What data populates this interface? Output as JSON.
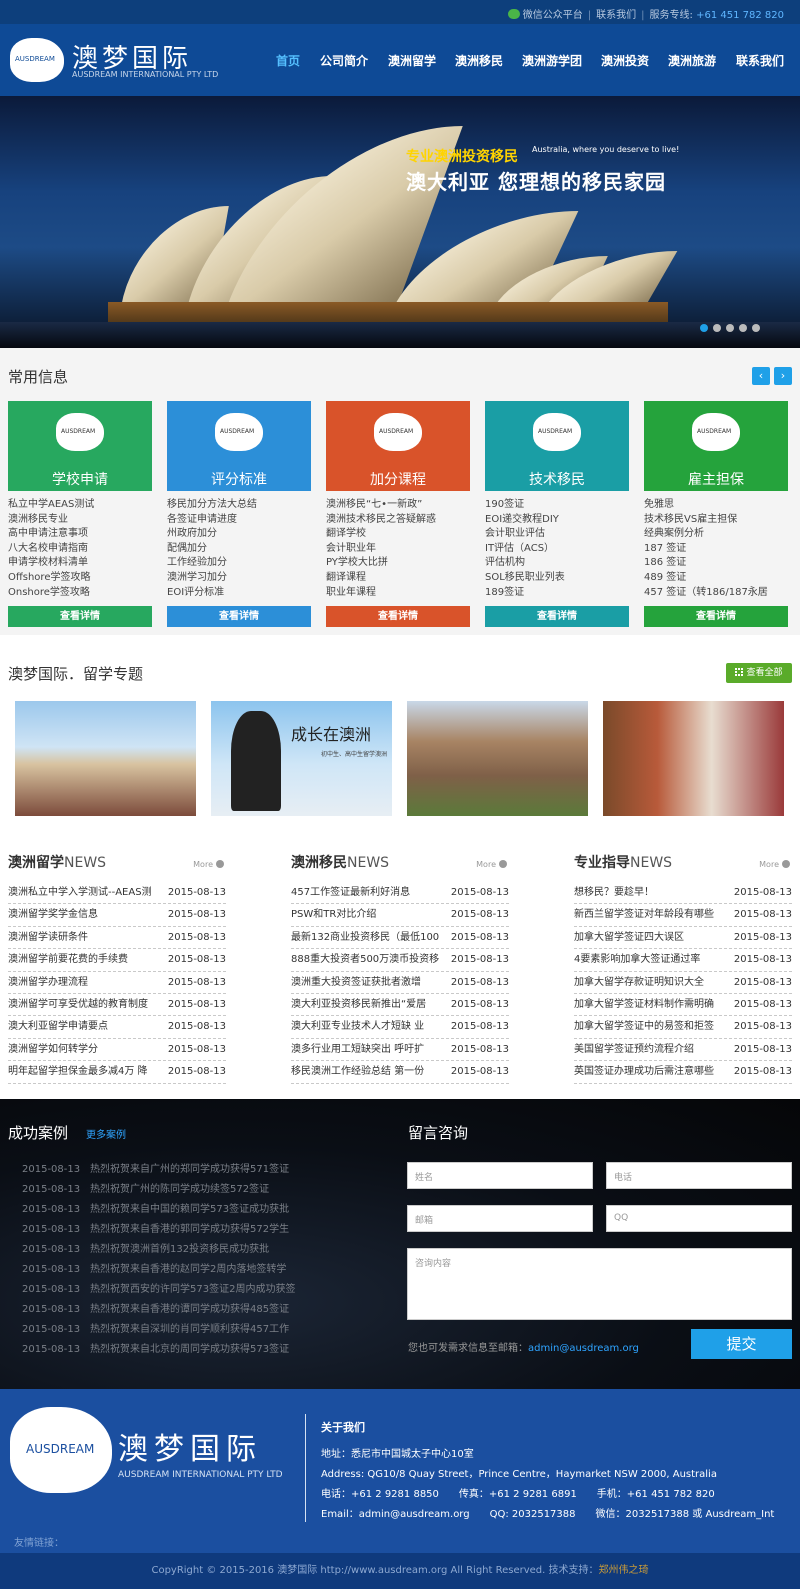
{
  "topbar": {
    "wechat": "微信公众平台",
    "contact": "联系我们",
    "hotline_label": "服务专线:",
    "hotline": "+61 451 782 820"
  },
  "logo": {
    "map_text": "AUSDREAM",
    "name_cn": "澳梦国际",
    "name_en": "AUSDREAM INTERNATIONAL PTY LTD"
  },
  "nav": {
    "items": [
      "首页",
      "公司简介",
      "澳洲留学",
      "澳洲移民",
      "澳洲游学团",
      "澳洲投资",
      "澳洲旅游",
      "联系我们"
    ],
    "active_index": 0
  },
  "banner": {
    "tagline_small": "专业澳洲投资移民",
    "tagline_en": "Australia, where you deserve to live!",
    "tagline_main": "澳大利亚  您理想的移民家园",
    "slide_count": 5,
    "active_slide": 0
  },
  "info": {
    "title": "常用信息",
    "prev": "‹",
    "next": "›",
    "cards": [
      {
        "title": "学校申请",
        "color": "#27a85f",
        "more": "查看详情",
        "items": [
          "私立中学AEAS测试",
          "澳洲移民专业",
          "高中申请注意事项",
          "八大名校申请指南",
          "申请学校材料清单",
          "Offshore学签攻略",
          "Onshore学签攻略"
        ]
      },
      {
        "title": "评分标准",
        "color": "#2c8fd8",
        "more": "查看详情",
        "items": [
          "移民加分方法大总结",
          "各签证申请进度",
          "州政府加分",
          "配偶加分",
          "工作经验加分",
          "澳洲学习加分",
          "EOI评分标准"
        ]
      },
      {
        "title": "加分课程",
        "color": "#d9532a",
        "more": "查看详情",
        "items": [
          "澳洲移民“七•一新政”",
          "澳洲技术移民之答疑解惑",
          "翻译学校",
          "会计职业年",
          "PY学校大比拼",
          "翻译课程",
          "职业年课程"
        ]
      },
      {
        "title": "技术移民",
        "color": "#1a9ea5",
        "more": "查看详情",
        "items": [
          "190签证",
          "EOI递交教程DIY",
          "会计职业评估",
          "IT评估（ACS）",
          "评估机构",
          "SOL移民职业列表",
          "189签证"
        ]
      },
      {
        "title": "雇主担保",
        "color": "#25a33c",
        "more": "查看详情",
        "items": [
          "免雅思",
          "技术移民VS雇主担保",
          "经典案例分析",
          "187 签证",
          "186 签证",
          "489 签证",
          "457 签证（转186/187永居"
        ]
      }
    ]
  },
  "study": {
    "title": "澳梦国际．留学专题",
    "view_all": "查看全部",
    "photo_caption": "成长在澳洲",
    "photo_sub": "初中生、高中生留学澳洲"
  },
  "news": [
    {
      "title_bold": "澳洲留学",
      "title_en": "NEWS",
      "more": "More",
      "rows": [
        [
          "澳洲私立中学入学测试--AEAS测",
          "2015-08-13"
        ],
        [
          "澳洲留学奖学金信息",
          "2015-08-13"
        ],
        [
          "澳洲留学读研条件",
          "2015-08-13"
        ],
        [
          "澳洲留学前要花费的手续费",
          "2015-08-13"
        ],
        [
          "澳洲留学办理流程",
          "2015-08-13"
        ],
        [
          "澳洲留学可享受优越的教育制度",
          "2015-08-13"
        ],
        [
          "澳大利亚留学申请要点",
          "2015-08-13"
        ],
        [
          "澳洲留学如何转学分",
          "2015-08-13"
        ],
        [
          "明年起留学担保金最多减4万 降",
          "2015-08-13"
        ]
      ]
    },
    {
      "title_bold": "澳洲移民",
      "title_en": "NEWS",
      "more": "More",
      "rows": [
        [
          "457工作签证最新利好消息",
          "2015-08-13"
        ],
        [
          "PSW和TR对比介绍",
          "2015-08-13"
        ],
        [
          "最新132商业投资移民（最低100",
          "2015-08-13"
        ],
        [
          "888重大投资者500万澳币投资移",
          "2015-08-13"
        ],
        [
          "澳洲重大投资签证获批者激增",
          "2015-08-13"
        ],
        [
          "澳大利亚投资移民新推出“爱居",
          "2015-08-13"
        ],
        [
          "澳大利亚专业技术人才短缺 业",
          "2015-08-13"
        ],
        [
          "澳多行业用工短缺突出 呼吁扩",
          "2015-08-13"
        ],
        [
          "移民澳洲工作经验总结 第一份",
          "2015-08-13"
        ]
      ]
    },
    {
      "title_bold": "专业指导",
      "title_en": "NEWS",
      "more": "More",
      "rows": [
        [
          "想移民？要趁早！",
          "2015-08-13"
        ],
        [
          "新西兰留学签证对年龄段有哪些",
          "2015-08-13"
        ],
        [
          "加拿大留学签证四大误区",
          "2015-08-13"
        ],
        [
          "4要素影响加拿大签证通过率",
          "2015-08-13"
        ],
        [
          "加拿大留学存款证明知识大全",
          "2015-08-13"
        ],
        [
          "加拿大留学签证材料制作需明确",
          "2015-08-13"
        ],
        [
          "加拿大留学签证中的易签和拒签",
          "2015-08-13"
        ],
        [
          "美国留学签证预约流程介绍",
          "2015-08-13"
        ],
        [
          "英国签证办理成功后需注意哪些",
          "2015-08-13"
        ]
      ]
    }
  ],
  "cases": {
    "title": "成功案例",
    "more": "更多案例",
    "rows": [
      [
        "2015-08-13",
        "热烈祝贺来自广州的郑同学成功获得571签证"
      ],
      [
        "2015-08-13",
        "热烈祝贺广州的陈同学成功续签572签证"
      ],
      [
        "2015-08-13",
        "热烈祝贺来自中国的赖同学573签证成功获批"
      ],
      [
        "2015-08-13",
        "热烈祝贺来自香港的郭同学成功获得572学生"
      ],
      [
        "2015-08-13",
        "热烈祝贺澳洲首例132投资移民成功获批"
      ],
      [
        "2015-08-13",
        "热烈祝贺来自香港的赵同学2周内落地签转学"
      ],
      [
        "2015-08-13",
        "热烈祝贺西安的许同学573签证2周内成功获签"
      ],
      [
        "2015-08-13",
        "热烈祝贺来自香港的谭同学成功获得485签证"
      ],
      [
        "2015-08-13",
        "热烈祝贺来自深圳的肖同学顺利获得457工作"
      ],
      [
        "2015-08-13",
        "热烈祝贺来自北京的周同学成功获得573签证"
      ]
    ]
  },
  "message": {
    "title": "留言咨询",
    "name_ph": "姓名",
    "phone_ph": "电话",
    "email_ph": "邮箱",
    "qq_ph": "QQ",
    "content_ph": "咨询内容",
    "note": "您也可发需求信息至邮箱：",
    "note_email": "admin@ausdream.org",
    "submit": "提交"
  },
  "footer": {
    "map_text": "AUSDREAM",
    "name_cn": "澳梦国际",
    "name_en": "AUSDREAM INTERNATIONAL PTY LTD",
    "about_title": "关于我们",
    "address_cn": "地址：悉尼市中国城太子中心10室",
    "address_en": "Address: QG10/8 Quay Street，Prince Centre，Haymarket NSW 2000, Australia",
    "phones": "电话：+61 2 9281 8850　　传真：+61 2 9281 6891　　手机：+61 451 782 820",
    "contacts": "Email：admin@ausdream.org　　QQ: 2032517388　　微信：2032517388 或 Ausdream_Int",
    "friend_links": "友情链接：",
    "copyright": "CopyRight © 2015-2016 澳梦国际 http://www.ausdream.org All Right Reserved. 技术支持：",
    "tech_support": "郑州伟之琦"
  }
}
